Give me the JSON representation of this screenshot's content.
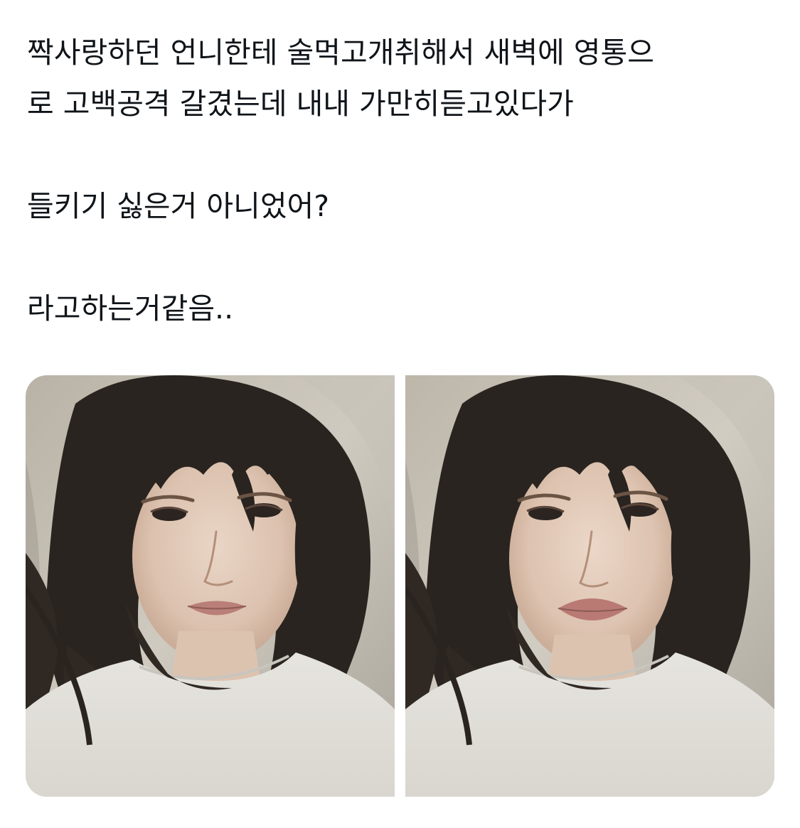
{
  "post": {
    "lines": [
      "짝사랑하던 언니한테 술먹고개취해서 새벽에 영통으",
      "로 고백공격 갈겼는데 내내 가만히듣고있다가",
      "",
      "들키기 싫은거 아니었어?",
      "",
      "라고하는거같음.."
    ]
  },
  "media": {
    "photos": [
      {
        "subject": "selfie-photo"
      },
      {
        "subject": "selfie-photo"
      }
    ]
  },
  "colors": {
    "text": "#0f1419",
    "background": "#ffffff"
  }
}
